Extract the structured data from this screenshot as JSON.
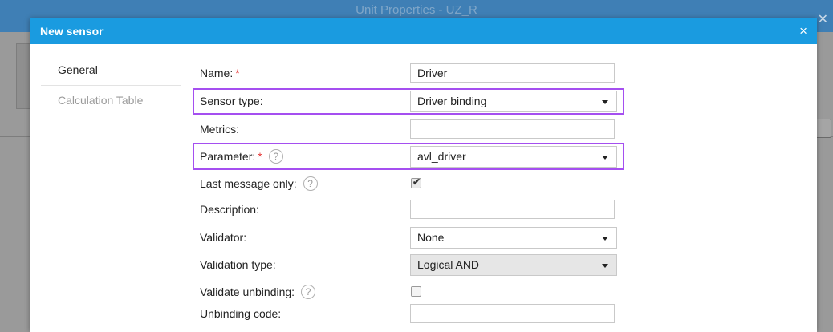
{
  "background": {
    "title": "Unit Properties - UZ_R",
    "close_glyph": "✕"
  },
  "modal": {
    "title": "New sensor",
    "close_glyph": "×"
  },
  "tabs": [
    {
      "label": "General",
      "active": true
    },
    {
      "label": "Calculation Table",
      "active": false
    }
  ],
  "form": {
    "name": {
      "label": "Name:",
      "required_mark": "*",
      "value": "Driver"
    },
    "sensor_type": {
      "label": "Sensor type:",
      "value": "Driver binding"
    },
    "metrics": {
      "label": "Metrics:",
      "value": ""
    },
    "parameter": {
      "label": "Parameter:",
      "required_mark": "*",
      "value": "avl_driver"
    },
    "last_message_only": {
      "label": "Last message only:",
      "checked": true
    },
    "description": {
      "label": "Description:",
      "value": ""
    },
    "validator": {
      "label": "Validator:",
      "value": "None"
    },
    "validation_type": {
      "label": "Validation type:",
      "value": "Logical AND"
    },
    "validate_unbinding": {
      "label": "Validate unbinding:",
      "checked": false
    },
    "unbinding_code": {
      "label": "Unbinding code:",
      "value": ""
    }
  },
  "help_glyph": "?",
  "checkmark_glyph": "✔",
  "colors": {
    "header": "#1a9be0",
    "highlight": "#a54ff0",
    "required": "#e53333"
  }
}
